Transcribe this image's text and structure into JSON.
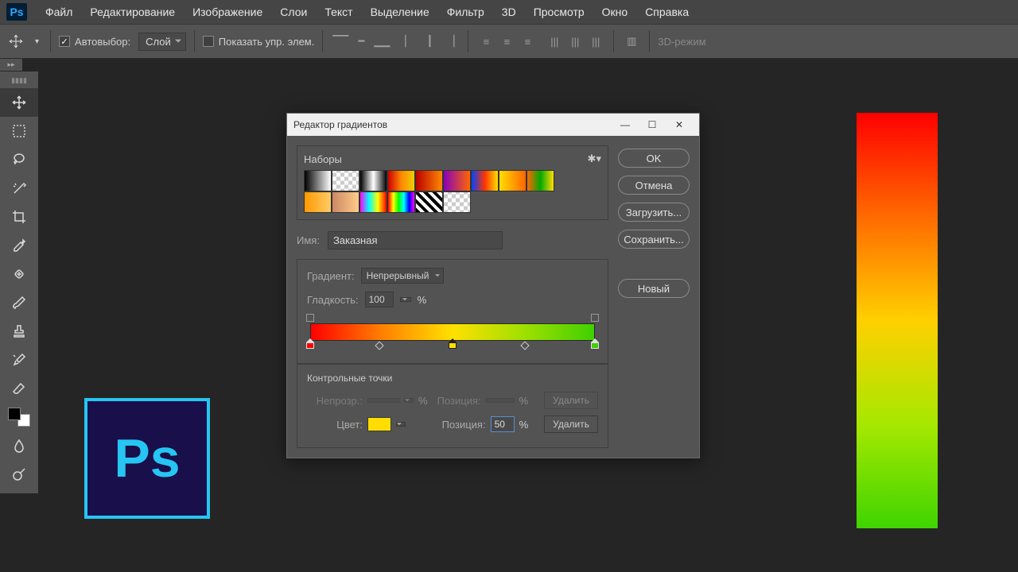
{
  "menu": {
    "items": [
      "Файл",
      "Редактирование",
      "Изображение",
      "Слои",
      "Текст",
      "Выделение",
      "Фильтр",
      "3D",
      "Просмотр",
      "Окно",
      "Справка"
    ]
  },
  "optbar": {
    "autoselect_label": "Автовыбор:",
    "layer_select": "Слой",
    "show_controls": "Показать упр. элем.",
    "mode3d": "3D-режим"
  },
  "dialog": {
    "title": "Редактор градиентов",
    "presets_label": "Наборы",
    "buttons": {
      "ok": "OK",
      "cancel": "Отмена",
      "load": "Загрузить...",
      "save": "Сохранить...",
      "new": "Новый"
    },
    "name_label": "Имя:",
    "name_value": "Заказная",
    "gradient_label": "Градиент:",
    "gradient_type": "Непрерывный",
    "smooth_label": "Гладкость:",
    "smooth_value": "100",
    "percent": "%",
    "ctrl_title": "Контрольные точки",
    "opacity_label": "Непрозр.:",
    "position_label": "Позиция:",
    "delete_label": "Удалить",
    "color_label": "Цвет:",
    "position_value": "50",
    "selected_color": "#ffdd00"
  },
  "ps_badge": "Ps",
  "gradient_stops": {
    "colors": [
      {
        "pos": 0,
        "color": "#ff0000"
      },
      {
        "pos": 50,
        "color": "#ffe000"
      },
      {
        "pos": 100,
        "color": "#40d000"
      }
    ],
    "midpoints": [
      25,
      75
    ],
    "opacity": [
      {
        "pos": 0
      },
      {
        "pos": 100
      }
    ]
  },
  "preset_swatches": [
    "linear-gradient(90deg,#000,#fff)",
    "repeating-conic-gradient(#ccc 0 25%,#fff 0 50%) 0/10px 10px",
    "linear-gradient(90deg,#000,#fff,#000)",
    "linear-gradient(90deg,#c00,#f80,#ec0)",
    "linear-gradient(90deg,#b00,#f80)",
    "linear-gradient(90deg,#80b,#f60)",
    "linear-gradient(90deg,#04f,#f30,#fd0)",
    "linear-gradient(90deg,#fd0,#f60)",
    "linear-gradient(90deg,#f60,#0a0,#fd0)",
    "linear-gradient(90deg,#f90,#fc6)",
    "linear-gradient(90deg,#c86,#fc8)",
    "linear-gradient(90deg,#f0f,#0ff,#ff0,#f00)",
    "linear-gradient(90deg,#f00,#ff0,#0f0,#0ff,#00f,#f0f)",
    "repeating-linear-gradient(45deg,#000 0 4px,#fff 4px 8px)",
    "repeating-conic-gradient(#ccc 0 25%,#fff 0 50%) 0/10px 10px"
  ]
}
